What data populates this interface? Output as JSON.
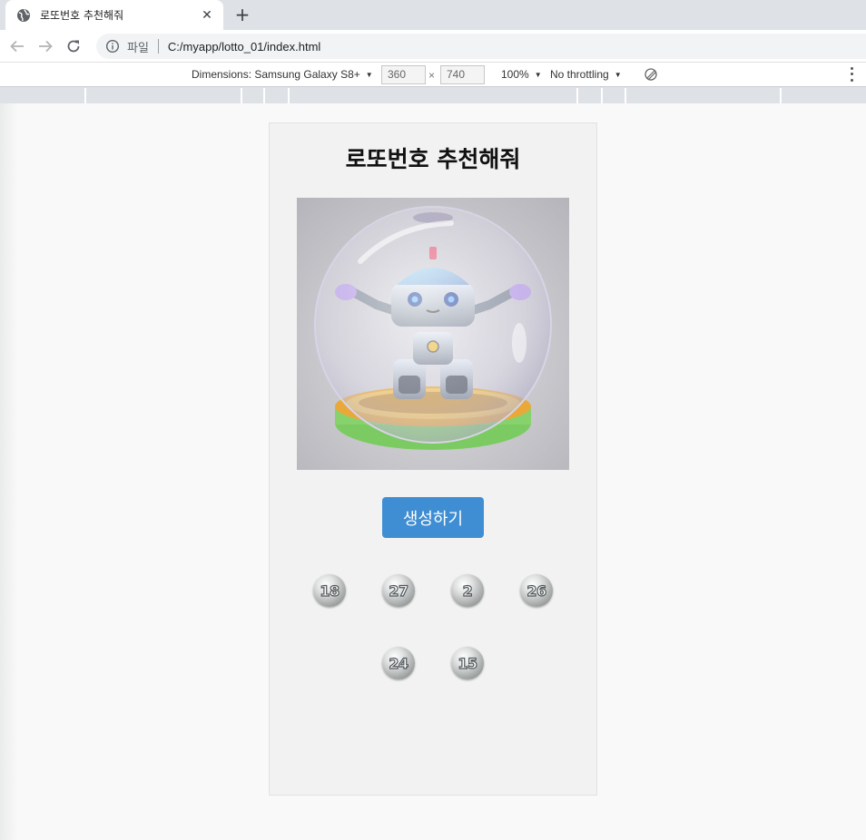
{
  "browser": {
    "tab": {
      "title": "로또번호 추천해줘"
    },
    "omnibox": {
      "scheme_label": "파일",
      "url": "C:/myapp/lotto_01/index.html"
    }
  },
  "devtools": {
    "device_label": "Dimensions: Samsung Galaxy S8+",
    "width": "360",
    "height": "740",
    "times": "×",
    "zoom": "100%",
    "throttling": "No throttling"
  },
  "app": {
    "title": "로또번호 추천해줘",
    "button_label": "생성하기",
    "numbers": [
      "18",
      "27",
      "2",
      "26",
      "24",
      "15"
    ]
  }
}
